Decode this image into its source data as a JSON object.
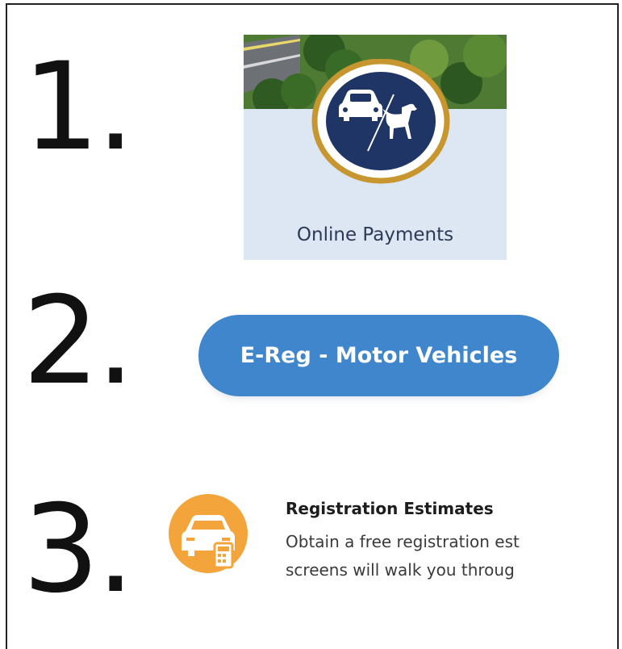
{
  "steps": [
    "1.",
    "2.",
    "3."
  ],
  "online_payments": {
    "label": "Online Payments",
    "icon": "car-slash-dog-icon",
    "badge_color": "#1e3566",
    "ring_color": "#c8962e"
  },
  "ereg": {
    "label": "E-Reg - Motor Vehicles",
    "color": "#3f86cc"
  },
  "registration_estimates": {
    "title": "Registration Estimates",
    "line1": "Obtain a free registration est",
    "line2": "screens will walk you throug",
    "icon": "car-calculator-icon",
    "icon_color": "#f3a53b"
  }
}
